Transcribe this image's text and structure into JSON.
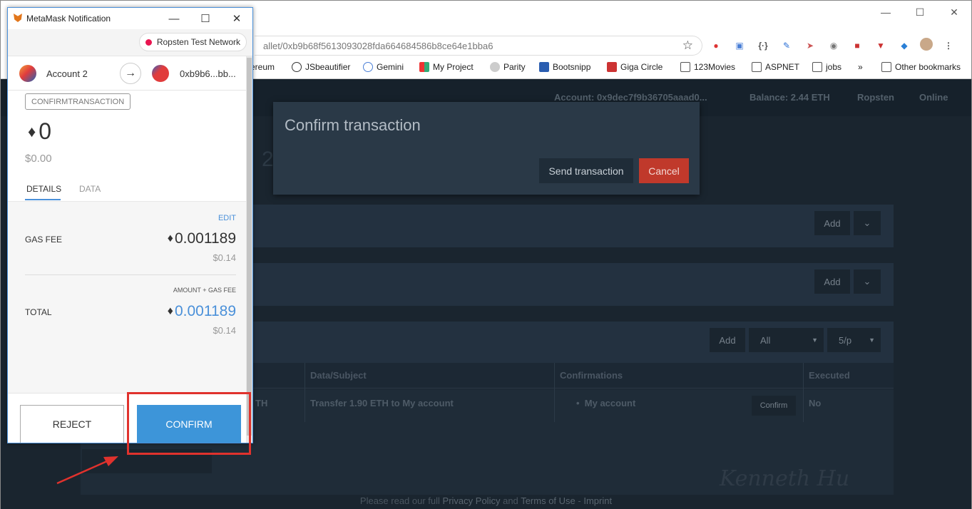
{
  "browser": {
    "address_url": "allet/0xb9b68f5613093028fda664684586b8ce64e1bba6",
    "bookmarks": [
      {
        "label": "ereum"
      },
      {
        "label": "JSbeautifier"
      },
      {
        "label": "Gemini"
      },
      {
        "label": "My Project"
      },
      {
        "label": "Parity"
      },
      {
        "label": "Bootsnipp"
      },
      {
        "label": "Giga Circle"
      },
      {
        "label": "123Movies"
      },
      {
        "label": "ASPNET"
      },
      {
        "label": "jobs"
      },
      {
        "label": "»"
      },
      {
        "label": "Other bookmarks"
      }
    ]
  },
  "dapp": {
    "account": "Account: 0x9dec7f9b36705aaad0...",
    "balance": "Balance: 2.44 ETH",
    "network": "Ropsten",
    "status": "Online",
    "big_number": "2",
    "add_label": "Add",
    "filter_all": "All",
    "per_page": "5/p",
    "table": {
      "headers": [
        "Data/Subject",
        "Confirmations",
        "Executed"
      ],
      "row": {
        "amount_fragment": "TH",
        "subject": "Transfer 1.90 ETH to My account",
        "confirmation": "My account",
        "confirm_btn": "Confirm",
        "executed": "No"
      }
    },
    "footer": {
      "prefix": "Please read our full",
      "privacy": "Privacy Policy",
      "and": "and",
      "terms": "Terms of Use",
      "sep": "-",
      "imprint": "Imprint"
    },
    "watermark": "Kenneth Hu"
  },
  "dapp_modal": {
    "title": "Confirm transaction",
    "send_label": "Send transaction",
    "cancel_label": "Cancel"
  },
  "metamask": {
    "window_title": "MetaMask Notification",
    "network": "Ropsten Test Network",
    "from_account": "Account 2",
    "to_account": "0xb9b6...bb...",
    "tx_type": "CONFIRMTRANSACTION",
    "amount": "0",
    "amount_fiat": "$0.00",
    "tabs": [
      "DETAILS",
      "DATA"
    ],
    "edit_label": "EDIT",
    "gas_fee_label": "GAS FEE",
    "gas_fee": "0.001189",
    "gas_fee_fiat": "$0.14",
    "amount_gas_label": "AMOUNT + GAS FEE",
    "total_label": "TOTAL",
    "total": "0.001189",
    "total_fiat": "$0.14",
    "reject_label": "REJECT",
    "confirm_label": "CONFIRM"
  },
  "colors": {
    "metamask_blue": "#3d95d9",
    "cancel_red": "#c0392b",
    "highlight_red": "#e0322d",
    "page_dark": "#1a252f"
  }
}
